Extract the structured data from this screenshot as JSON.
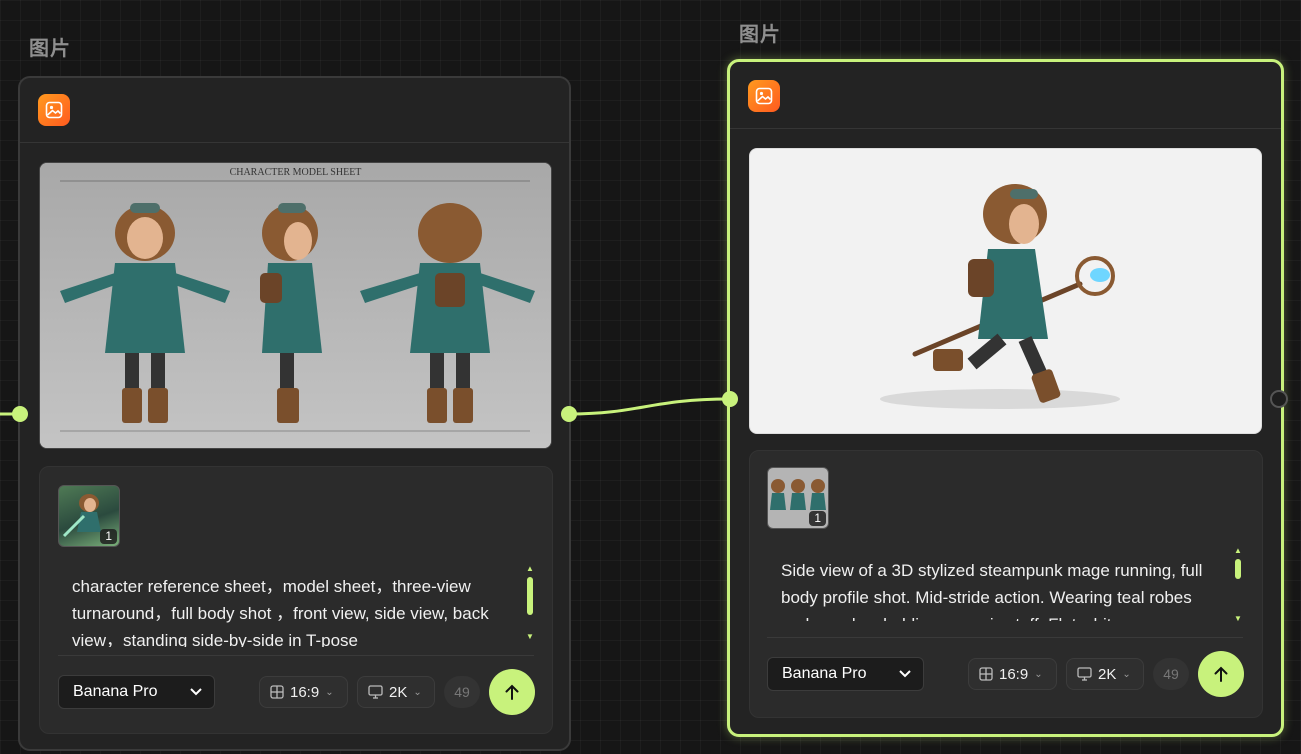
{
  "nodes": [
    {
      "title": "图片",
      "prompt": "character reference sheet，model sheet，three-view turnaround，full body shot ，front view, side view, back view，standing side-by-side in T-pose",
      "sheet_caption": "CHARACTER MODEL SHEET",
      "reference_count": "1",
      "model": "Banana Pro",
      "aspect_ratio": "16:9",
      "resolution": "2K",
      "credits": "49"
    },
    {
      "title": "图片",
      "prompt": "Side view of a 3D stylized steampunk mage running, full body profile shot. Mid-stride action. Wearing teal robes and goggles, holding a magic staff. Flat white",
      "reference_count": "1",
      "model": "Banana Pro",
      "aspect_ratio": "16:9",
      "resolution": "2K",
      "credits": "49"
    }
  ],
  "icons": {
    "node_type": "image-icon",
    "aspect": "grid-icon",
    "resolution": "monitor-icon",
    "send": "arrow-up-icon",
    "dropdown": "chevron-down-icon"
  },
  "colors": {
    "accent": "#c8f27c",
    "node_icon": "#ff7a1f",
    "canvas": "#161616"
  }
}
